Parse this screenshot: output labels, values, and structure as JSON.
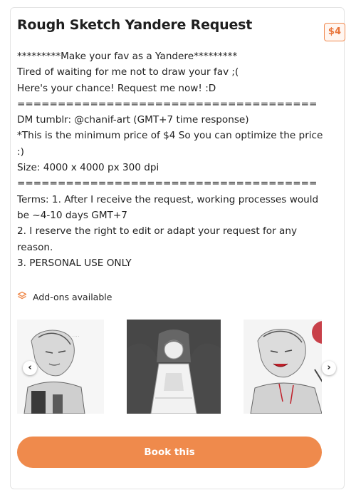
{
  "listing": {
    "title": "Rough Sketch Yandere Request",
    "price": "$4",
    "description": [
      "*********Make your fav as a Yandere*********",
      "Tired of waiting for me not to draw your fav ;(",
      "Here's your chance! Request me now! :D",
      "=====================================",
      "DM tumblr: @chanif-art (GMT+7 time response)",
      "*This is the minimum price of $4 So you can optimize the price :)",
      "Size: 4000 x 4000 px 300 dpi",
      "=====================================",
      "Terms: 1. After I receive the request, working processes would be ~4-10 days GMT+7",
      "2. I reserve the right to edit or adapt your request for any reason.",
      "3. PERSONAL USE ONLY"
    ],
    "addons_label": "Add-ons available",
    "gallery": {
      "prev_icon": "‹",
      "next_icon": "›",
      "images": [
        "sketch-1",
        "sketch-2",
        "sketch-3"
      ]
    },
    "book_label": "Book this"
  },
  "colors": {
    "accent": "#ef8a4c",
    "price_border": "#f0894f",
    "blood": "#c0202a"
  },
  "icons": {
    "addons": "layers-icon",
    "prev": "chevron-left-icon",
    "next": "chevron-right-icon"
  }
}
